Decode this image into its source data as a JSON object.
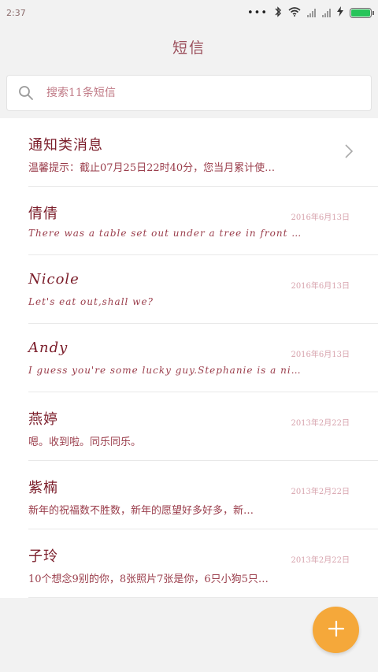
{
  "status_bar": {
    "time": "2:37",
    "dots": "•••",
    "battery_color": "#27c45a"
  },
  "header": {
    "title": "短信"
  },
  "search": {
    "placeholder": "搜索11条短信",
    "icon": "search-icon"
  },
  "conversations": [
    {
      "name": "通知类消息",
      "preview": "温馨提示：截止07月25日22时40分，您当月累计使…",
      "date": "",
      "has_chevron": true
    },
    {
      "name": "倩倩",
      "preview": "There was a table set out under a tree in front of the…",
      "date": "2016年6月13日"
    },
    {
      "name": "Nicole",
      "preview": "Let's eat out,shall we?",
      "date": "2016年6月13日"
    },
    {
      "name": "Andy",
      "preview": "I guess you're some lucky guy.Stephanie is a nice girl.",
      "date": "2016年6月13日"
    },
    {
      "name": "燕婷",
      "preview": "嗯。收到啦。同乐同乐。",
      "date": "2013年2月22日"
    },
    {
      "name": "紫楠",
      "preview": "新年的祝福数不胜数，新年的愿望好多好多，新…",
      "date": "2013年2月22日"
    },
    {
      "name": "子玲",
      "preview": "10个想念9别的你，8张照片7张是你，6只小狗5只…",
      "date": "2013年2月22日"
    }
  ],
  "fab": {
    "icon": "plus-icon",
    "color": "#f5a83a"
  }
}
